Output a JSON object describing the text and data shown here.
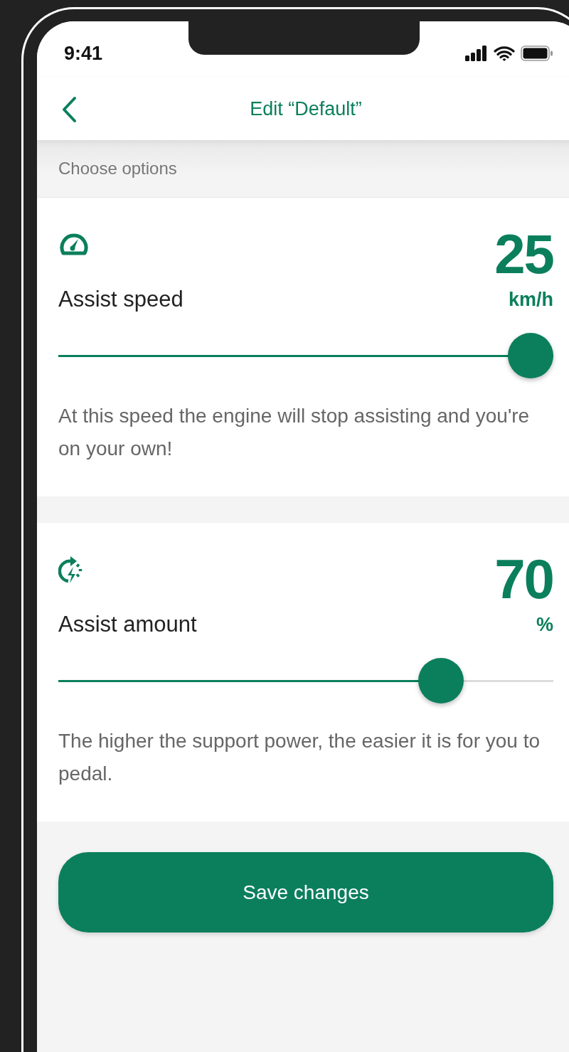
{
  "status_bar": {
    "time": "9:41"
  },
  "header": {
    "title": "Edit “Default”"
  },
  "section_label": "Choose options",
  "options": [
    {
      "kind": "speed",
      "label": "Assist speed",
      "value": "25",
      "unit": "km/h",
      "level": 1.0,
      "description": "At this speed the engine will stop assisting and you're on your own!"
    },
    {
      "kind": "amount",
      "label": "Assist amount",
      "value": "70",
      "unit": "%",
      "level": 0.8,
      "description": "The higher the support power, the easier it is for you to pedal."
    }
  ],
  "save_button": {
    "label": "Save changes"
  }
}
